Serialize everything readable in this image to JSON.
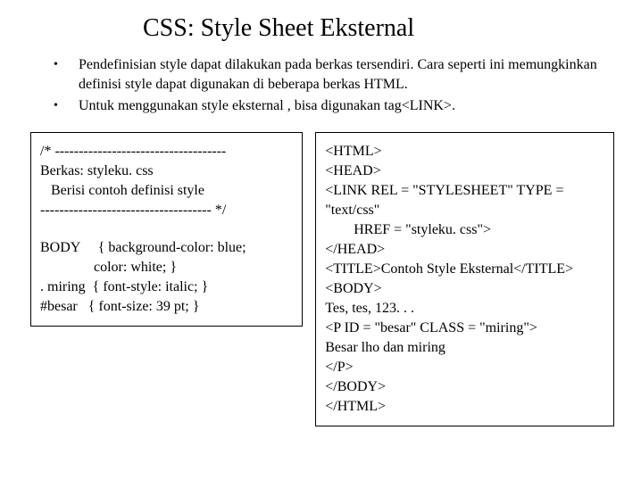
{
  "title": "CSS: Style Sheet Eksternal",
  "bullets": {
    "item1": "Pendefinisian style dapat dilakukan pada berkas tersendiri. Cara seperti ini memungkinkan definisi style dapat digunakan di beberapa berkas HTML.",
    "item2": "Untuk menggunakan style eksternal , bisa digunakan tag<LINK>."
  },
  "leftbox": {
    "l1": "/* ------------------------------------",
    "l2": "Berkas: styleku. css",
    "l3": "   Berisi contoh definisi style",
    "l4": "------------------------------------ */",
    "l5": "BODY     { background-color: blue;",
    "l6": "               color: white; }",
    "l7": ". miring  { font-style: italic; }",
    "l8": "#besar   { font-size: 39 pt; }"
  },
  "rightbox": {
    "r1": "<HTML>",
    "r2": "<HEAD>",
    "r3": "<LINK REL = \"STYLESHEET\" TYPE = \"text/css\"",
    "r4": "        HREF = \"styleku. css\">",
    "r5": "</HEAD>",
    "r6": "<TITLE>Contoh Style Eksternal</TITLE>",
    "r7": "<BODY>",
    "r8": "Tes, tes, 123. . .",
    "r9": "<P ID = \"besar\" CLASS = \"miring\">",
    "r10": "Besar lho dan miring",
    "r11": "</P>",
    "r12": "</BODY>",
    "r13": "</HTML>"
  }
}
